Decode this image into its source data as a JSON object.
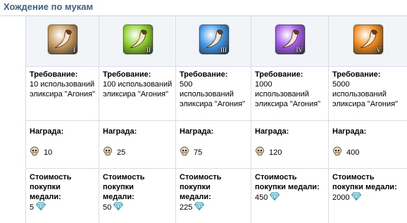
{
  "header": {
    "title": "Хождение по мукам"
  },
  "labels": {
    "requirement": "Требование:",
    "reward": "Награда:",
    "cost_line1": "Стоимость",
    "cost_line2": "покупки",
    "cost_line3": "медали:"
  },
  "tiers": [
    {
      "numeral": "I",
      "accent": "#c89a5e",
      "req_lines": [
        "10 использований",
        "эликсира \"Агония\""
      ],
      "reward": "10",
      "cost": "5"
    },
    {
      "numeral": "II",
      "accent": "#8fcf2a",
      "req_lines": [
        "100 использований",
        "эликсира \"Агония\""
      ],
      "reward": "25",
      "cost": "50"
    },
    {
      "numeral": "III",
      "accent": "#3f96e6",
      "req_lines": [
        "500 использований",
        "эликсира \"Агония\""
      ],
      "reward": "75",
      "cost": "225"
    },
    {
      "numeral": "IV",
      "accent": "#a35ae8",
      "req_lines": [
        "1000",
        "использований",
        "эликсира \"Агония\""
      ],
      "reward": "120",
      "cost": "450"
    },
    {
      "numeral": "V",
      "accent": "#f08a1a",
      "req_lines": [
        "5000",
        "использований",
        "эликсира \"Агония\""
      ],
      "reward": "400",
      "cost": "2000"
    }
  ],
  "icons": {
    "medal": "horn-icon",
    "reward_currency": "skull-icon",
    "cost_currency": "diamond-icon"
  }
}
